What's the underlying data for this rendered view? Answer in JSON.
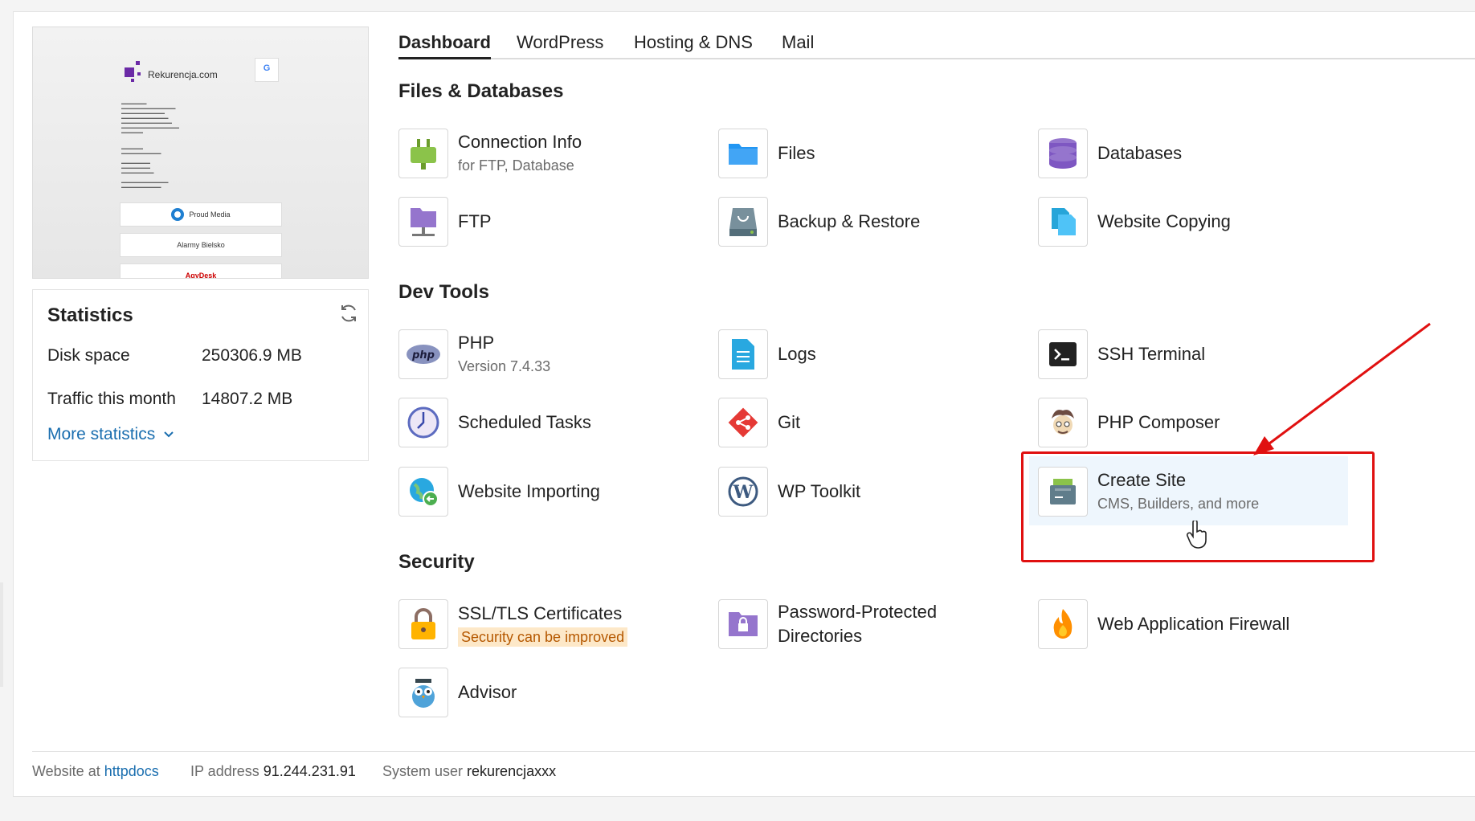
{
  "preview": {
    "site_title": "Rekurencja.com",
    "partner1": "Proud Media",
    "partner2": "Alarmy Bielsko",
    "partner3": "AgyDesk"
  },
  "statistics": {
    "title": "Statistics",
    "disk_label": "Disk space",
    "disk_value": "250306.9 MB",
    "traffic_label": "Traffic this month",
    "traffic_value": "14807.2 MB",
    "more_label": "More statistics"
  },
  "tabs": [
    "Dashboard",
    "WordPress",
    "Hosting & DNS",
    "Mail"
  ],
  "sections": {
    "files": "Files & Databases",
    "dev": "Dev Tools",
    "security": "Security"
  },
  "tools": {
    "connection_info": {
      "name": "Connection Info",
      "sub": "for FTP, Database"
    },
    "files": {
      "name": "Files"
    },
    "databases": {
      "name": "Databases"
    },
    "ftp": {
      "name": "FTP"
    },
    "backup": {
      "name": "Backup & Restore"
    },
    "website_copying": {
      "name": "Website Copying"
    },
    "php": {
      "name": "PHP",
      "sub": "Version 7.4.33"
    },
    "logs": {
      "name": "Logs"
    },
    "ssh": {
      "name": "SSH Terminal"
    },
    "scheduled": {
      "name": "Scheduled Tasks"
    },
    "git": {
      "name": "Git"
    },
    "composer": {
      "name": "PHP Composer"
    },
    "importing": {
      "name": "Website Importing"
    },
    "wp_toolkit": {
      "name": "WP Toolkit"
    },
    "create_site": {
      "name": "Create Site",
      "sub": "CMS, Builders, and more"
    },
    "ssl": {
      "name": "SSL/TLS Certificates",
      "warn": "Security can be improved"
    },
    "password_dirs": {
      "name1": "Password-Protected",
      "name2": "Directories"
    },
    "waf": {
      "name": "Web Application Firewall"
    },
    "advisor": {
      "name": "Advisor"
    }
  },
  "footer": {
    "website_label": "Website at",
    "website_link": "httpdocs",
    "ip_label": "IP address",
    "ip_value": "91.244.231.91",
    "user_label": "System user",
    "user_value": "rekurencjaxxx"
  },
  "colors": {
    "link": "#1a6eaf",
    "highlight": "#e01010",
    "warn_bg": "#fde8c8"
  }
}
